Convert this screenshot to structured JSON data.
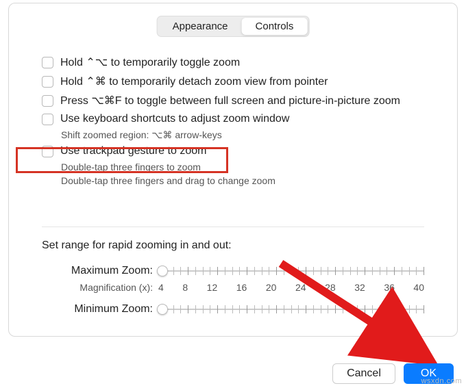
{
  "tabs": {
    "appearance": "Appearance",
    "controls": "Controls"
  },
  "options": {
    "hold_toggle": "Hold ⌃⌥ to temporarily toggle zoom",
    "hold_detach": "Hold ⌃⌘ to temporarily detach zoom view from pointer",
    "press_toggle": "Press ⌥⌘F to toggle between full screen and picture-in-picture zoom",
    "keyboard_shortcuts": "Use keyboard shortcuts to adjust zoom window",
    "shift_region": "Shift zoomed region:   ⌥⌘ arrow-keys",
    "trackpad": "Use trackpad gesture to zoom",
    "trackpad_sub1": "Double-tap three fingers to zoom",
    "trackpad_sub2": "Double-tap three fingers and drag to change zoom"
  },
  "range": {
    "title": "Set range for rapid zooming in and out:",
    "max_label": "Maximum Zoom:",
    "mag_label": "Magnification (x):",
    "min_label": "Minimum Zoom:",
    "values": [
      "4",
      "8",
      "12",
      "16",
      "20",
      "24",
      "28",
      "32",
      "36",
      "40"
    ]
  },
  "buttons": {
    "cancel": "Cancel",
    "ok": "OK"
  },
  "watermark": "wsxdn.com",
  "colors": {
    "highlight": "#d53324",
    "arrow": "#e11b1b",
    "primary": "#0a7cff"
  }
}
